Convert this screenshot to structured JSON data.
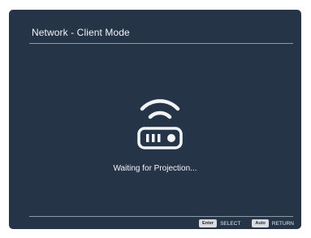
{
  "header": {
    "title": "Network - Client Mode"
  },
  "main": {
    "status_text": "Waiting for Projection...",
    "icon": "wifi-router-icon"
  },
  "footer": {
    "hints": [
      {
        "key": "Enter",
        "label": "SELECT"
      },
      {
        "key": "Auto",
        "label": "RETURN"
      }
    ]
  },
  "colors": {
    "background": "#253447",
    "text": "#f2f4f7",
    "rule": "#8d99a8",
    "key_bg": "#d9dde2"
  }
}
